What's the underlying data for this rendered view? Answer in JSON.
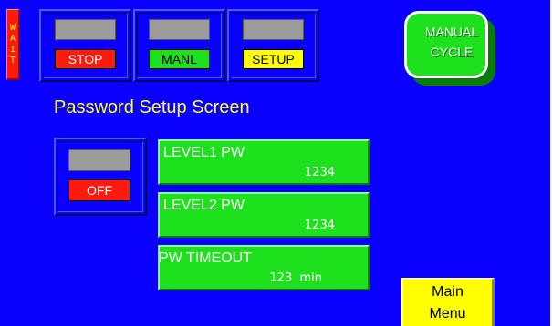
{
  "status": {
    "wait_letters": [
      "W",
      "A",
      "I",
      "T"
    ]
  },
  "mode_buttons": [
    {
      "label": "STOP",
      "color": "#ff1a10"
    },
    {
      "label": "MANL",
      "color": "#1ee11e"
    },
    {
      "label": "SETUP",
      "color": "#ffff00"
    }
  ],
  "manual_cycle": {
    "line1": "MANUAL",
    "line2": "CYCLE"
  },
  "page_title": "Password Setup Screen",
  "toggle": {
    "state_label": "OFF"
  },
  "password_fields": [
    {
      "name": "LEVEL1 PW",
      "value": "1234"
    },
    {
      "name": "LEVEL2 PW",
      "value": "1234"
    },
    {
      "name": "PW TIMEOUT",
      "value": "123  min"
    }
  ],
  "main_menu": {
    "line1": "Main",
    "line2": "Menu"
  },
  "colors": {
    "background": "#0a00ff",
    "title_text": "#ffff33",
    "field_green": "#1ee11e"
  }
}
